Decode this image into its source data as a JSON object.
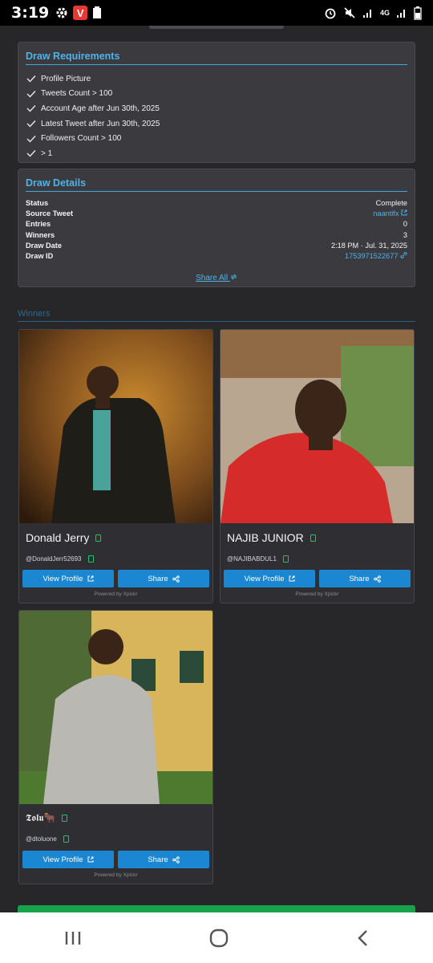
{
  "status_bar": {
    "time": "3:19",
    "net": "4G"
  },
  "requirements": {
    "title": "Draw Requirements",
    "items": [
      "Profile Picture",
      "Tweets Count > 100",
      "Account Age after Jun 30th, 2025",
      "Latest Tweet after Jun 30th, 2025",
      "Followers Count > 100",
      "> 1"
    ]
  },
  "details": {
    "title": "Draw Details",
    "rows": [
      {
        "key": "Status",
        "value": "Complete"
      },
      {
        "key": "Source Tweet",
        "value": "naantifx"
      },
      {
        "key": "Entries",
        "value": "0"
      },
      {
        "key": "Winners",
        "value": "3"
      },
      {
        "key": "Draw Date",
        "value": "2:18 PM · Jul. 31, 2025"
      },
      {
        "key": "Draw ID",
        "value": "1753971522677"
      }
    ],
    "share_all": "Share All"
  },
  "winners": {
    "title": "Winners",
    "view_label": "View Profile",
    "share_label": "Share",
    "powered": "Powered by Xpickr",
    "list": [
      {
        "name": "Donald Jerry",
        "handle": "@DonaldJerr52693"
      },
      {
        "name": "NAJIB JUNIOR",
        "handle": "@NAJIBABDUL1"
      },
      {
        "name": "𝕿𝖔𝖑𝖚🐂",
        "handle": "@dtoluone"
      }
    ]
  },
  "colors": {
    "accent": "#4fb3ea",
    "button": "#1b86d1",
    "background": "#27272a",
    "card": "#3a3a3f",
    "success": "#16a34a"
  }
}
